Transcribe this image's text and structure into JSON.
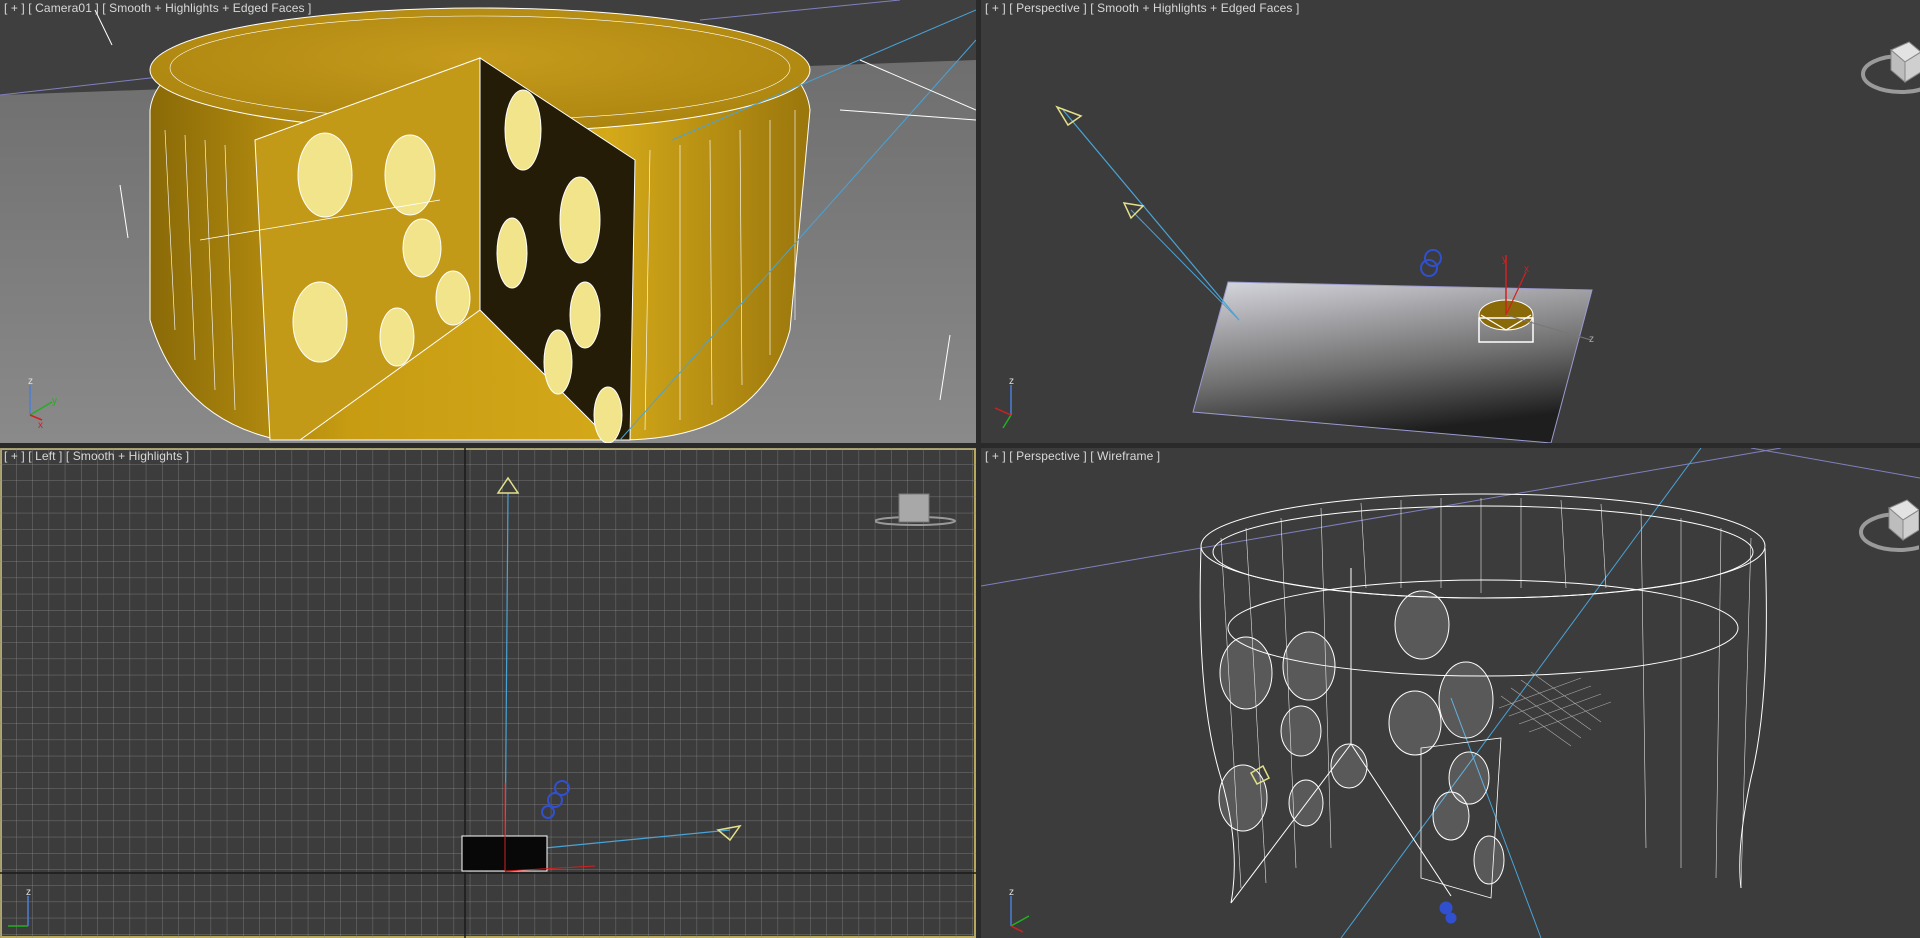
{
  "viewports": {
    "top_left": {
      "menu": "[ + ]",
      "view": "[ Camera01 ]",
      "shading": "[ Smooth + Highlights + Edged Faces ]"
    },
    "top_right": {
      "menu": "[ + ]",
      "view": "[ Perspective ]",
      "shading": "[ Smooth + Highlights + Edged Faces ]"
    },
    "bottom_left": {
      "menu": "[ + ]",
      "view": "[ Left ]",
      "shading": "[ Smooth + Highlights ]"
    },
    "bottom_right": {
      "menu": "[ + ]",
      "view": "[ Perspective ]",
      "shading": "[ Wireframe ]"
    }
  },
  "axis_labels": {
    "x": "x",
    "y": "y",
    "z": "z"
  },
  "colors": {
    "viewport_bg": "#3c3c3c",
    "cheese": "#c9a221",
    "cheese_dark": "#2a2208",
    "wire": "#ffffff",
    "light_line": "#4aa3d6",
    "grid": "#8a8a8a",
    "active_border": "#b7a85a",
    "axis_x": "#d22020",
    "axis_y": "#20b020",
    "axis_z": "#4a7fd6"
  },
  "icons": [
    "viewcube-icon",
    "camera-target-icon",
    "light-icon",
    "axis-tripod-icon"
  ]
}
